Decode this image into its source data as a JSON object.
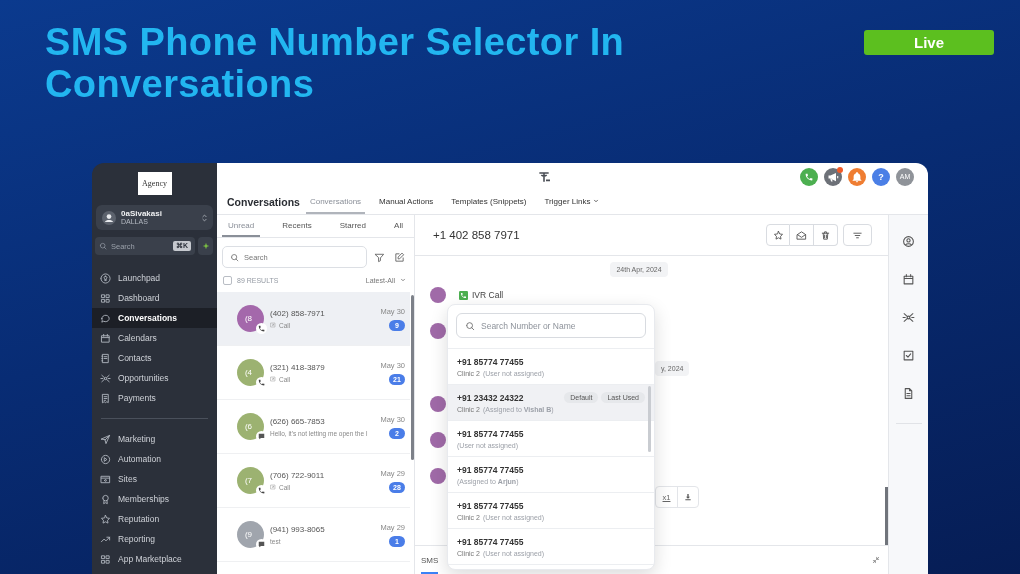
{
  "slide": {
    "title": "SMS Phone Number Selector In Conversations",
    "status_badge": "Live"
  },
  "sidebar": {
    "logo": "Agency",
    "account": {
      "name": "0aSivakasi",
      "location": "DALLAS"
    },
    "search": {
      "placeholder": "Search",
      "shortcut": "⌘K"
    },
    "sections": [
      {
        "items": [
          {
            "label": "Launchpad",
            "selected": false
          },
          {
            "label": "Dashboard",
            "selected": false
          },
          {
            "label": "Conversations",
            "selected": true
          },
          {
            "label": "Calendars",
            "selected": false
          },
          {
            "label": "Contacts",
            "selected": false
          },
          {
            "label": "Opportunities",
            "selected": false
          },
          {
            "label": "Payments",
            "selected": false
          }
        ]
      },
      {
        "items": [
          {
            "label": "Marketing",
            "selected": false
          },
          {
            "label": "Automation",
            "selected": false
          },
          {
            "label": "Sites",
            "selected": false
          },
          {
            "label": "Memberships",
            "selected": false
          },
          {
            "label": "Reputation",
            "selected": false
          },
          {
            "label": "Reporting",
            "selected": false
          },
          {
            "label": "App Marketplace",
            "selected": false
          }
        ]
      }
    ]
  },
  "top_bar": {
    "title": "Conversations",
    "tabs": [
      {
        "label": "Conversations",
        "selected": true,
        "kind": "link"
      },
      {
        "label": "Manual Actions",
        "selected": false,
        "kind": "link"
      },
      {
        "label": "Templates (Snippets)",
        "selected": false,
        "kind": "link"
      },
      {
        "label": "Trigger Links",
        "selected": false,
        "kind": "menu"
      }
    ],
    "announcements_unread": true,
    "help_label": "?",
    "user_initials": "AM"
  },
  "conversation_list": {
    "tabs": [
      {
        "label": "Unread",
        "selected": true
      },
      {
        "label": "Recents",
        "selected": false
      },
      {
        "label": "Starred",
        "selected": false
      },
      {
        "label": "All",
        "selected": false
      }
    ],
    "search": {
      "placeholder": "Search"
    },
    "select_all": {
      "checked": false
    },
    "results": "89 RESULTS",
    "sort": "Latest-All",
    "items": [
      {
        "avatar": "(8",
        "color": "#a468ab",
        "kind": "call",
        "name": "(402) 858-7971",
        "preview": "Call",
        "date": "May 30",
        "unread": "9",
        "selected": true
      },
      {
        "avatar": "(4",
        "color": "#9cb271",
        "kind": "call",
        "name": "(321) 418-3879",
        "preview": "Call",
        "date": "May 30",
        "unread": "21",
        "selected": false
      },
      {
        "avatar": "(6",
        "color": "#9cb271",
        "kind": "message",
        "name": "(626) 665-7853",
        "preview": "Hello, it's not letting me open the l",
        "date": "May 30",
        "unread": "2",
        "selected": false
      },
      {
        "avatar": "(7",
        "color": "#9cb271",
        "kind": "call",
        "name": "(706) 722-9011",
        "preview": "Call",
        "date": "May 29",
        "unread": "28",
        "selected": false
      },
      {
        "avatar": "(9",
        "color": "#a0a5ad",
        "kind": "message",
        "name": "(941) 993-8065",
        "preview": "test",
        "date": "May 29",
        "unread": "1",
        "selected": false
      }
    ]
  },
  "conversation": {
    "title": "+1 402 858 7971",
    "messages": [
      {
        "kind": "date",
        "text": "24th Apr, 2024"
      },
      {
        "kind": "event",
        "text": "IVR Call"
      },
      {
        "kind": "message"
      },
      {
        "kind": "date",
        "text": "y, 2024"
      },
      {
        "kind": "message"
      },
      {
        "kind": "message"
      },
      {
        "kind": "audio",
        "speed": "x1"
      }
    ],
    "composer_tabs": [
      {
        "label": "SMS",
        "selected": true
      }
    ]
  },
  "number_picker": {
    "search": {
      "placeholder": "Search Number or Name"
    },
    "options": [
      {
        "number": "+91 85774 77455",
        "location": "Clinic 2",
        "assignment": "(User not assigned)",
        "selected": false
      },
      {
        "number": "+91 23432 24322",
        "location": "Clinic 2",
        "assignment": "(Assigned to **Vishal B**)",
        "tags": [
          "Default",
          "Last Used"
        ],
        "selected": true
      },
      {
        "number": "+91 85774 77455",
        "assignment": "(User not assigned)",
        "selected": false
      },
      {
        "number": "+91 85774 77455",
        "assignment": "(Assigned to **Arjun**)",
        "selected": false
      },
      {
        "number": "+91 85774 77455",
        "location": "Clinic 2",
        "assignment": "(User not assigned)",
        "selected": false
      },
      {
        "number": "+91 85774 77455",
        "location": "Clinic 2",
        "assignment": "(User not assigned)",
        "selected": false
      }
    ]
  }
}
